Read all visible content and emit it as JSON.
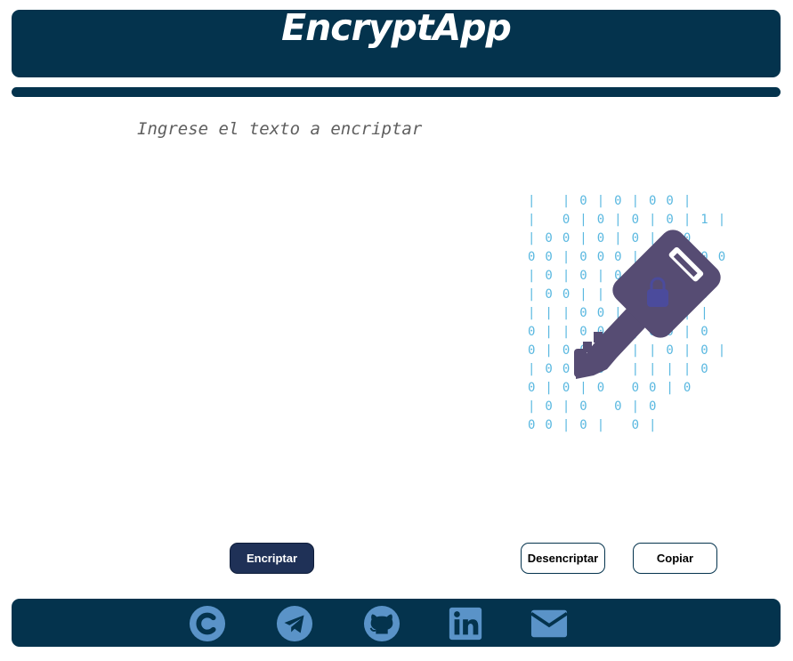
{
  "header": {
    "title": "EncryptApp"
  },
  "main": {
    "input_placeholder": "Ingrese el texto a encriptar",
    "illustration": {
      "icon": "key-with-binary-icon",
      "binary_rows": [
        "|  |0|0|00|",
        "| 0|0|0|0|1|",
        "|00|0|0|00",
        "00|000|00|00",
        "  |0|0|0|0|",
        "|00||0|0||0",
        "|||00|0|0||",
        "0||00||00|0",
        "0|00|0||0|0|",
        "|00|0 ||||0",
        " 0|0|0 00|0",
        " |0|0  0|0",
        " 00|0| 0|"
      ]
    }
  },
  "actions": {
    "encrypt_label": "Encriptar",
    "decrypt_label": "Desencriptar",
    "copy_label": "Copiar"
  },
  "footer": {
    "links": [
      {
        "name": "copyright-icon"
      },
      {
        "name": "telegram-icon"
      },
      {
        "name": "github-icon"
      },
      {
        "name": "linkedin-icon"
      },
      {
        "name": "mail-icon"
      }
    ]
  },
  "colors": {
    "primary": "#04334d",
    "button_primary": "#1f3157",
    "icon": "#5a93c8",
    "key": "#564c73",
    "binary": "#5ab8e0"
  }
}
